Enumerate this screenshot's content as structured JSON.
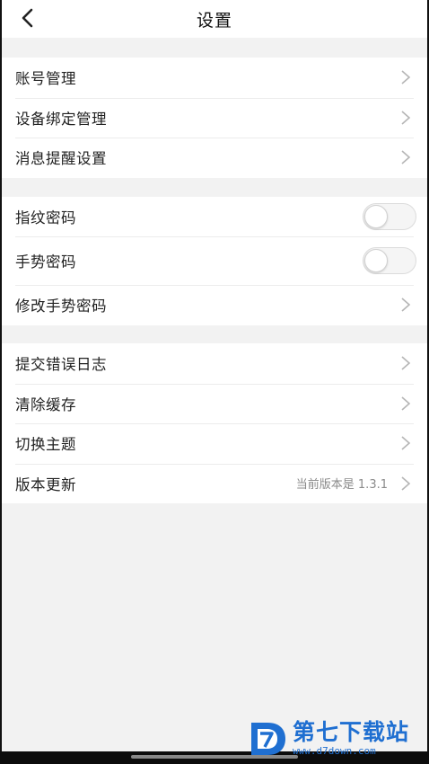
{
  "nav": {
    "title": "设置"
  },
  "groups": [
    {
      "items": [
        {
          "label": "账号管理"
        },
        {
          "label": "设备绑定管理"
        },
        {
          "label": "消息提醒设置"
        }
      ]
    },
    {
      "items": [
        {
          "label": "指纹密码",
          "toggle_on": false
        },
        {
          "label": "手势密码",
          "toggle_on": false
        },
        {
          "label": "修改手势密码"
        }
      ]
    },
    {
      "items": [
        {
          "label": "提交错误日志"
        },
        {
          "label": "清除缓存"
        },
        {
          "label": "切换主题"
        },
        {
          "label": "版本更新",
          "value": "当前版本是 1.3.1"
        }
      ]
    }
  ],
  "watermark": {
    "main": "第七下载站",
    "url": "www.d7down.com"
  },
  "colors": {
    "accent": "#1f6fd1",
    "background": "#f2f2f2",
    "surface": "#ffffff"
  }
}
